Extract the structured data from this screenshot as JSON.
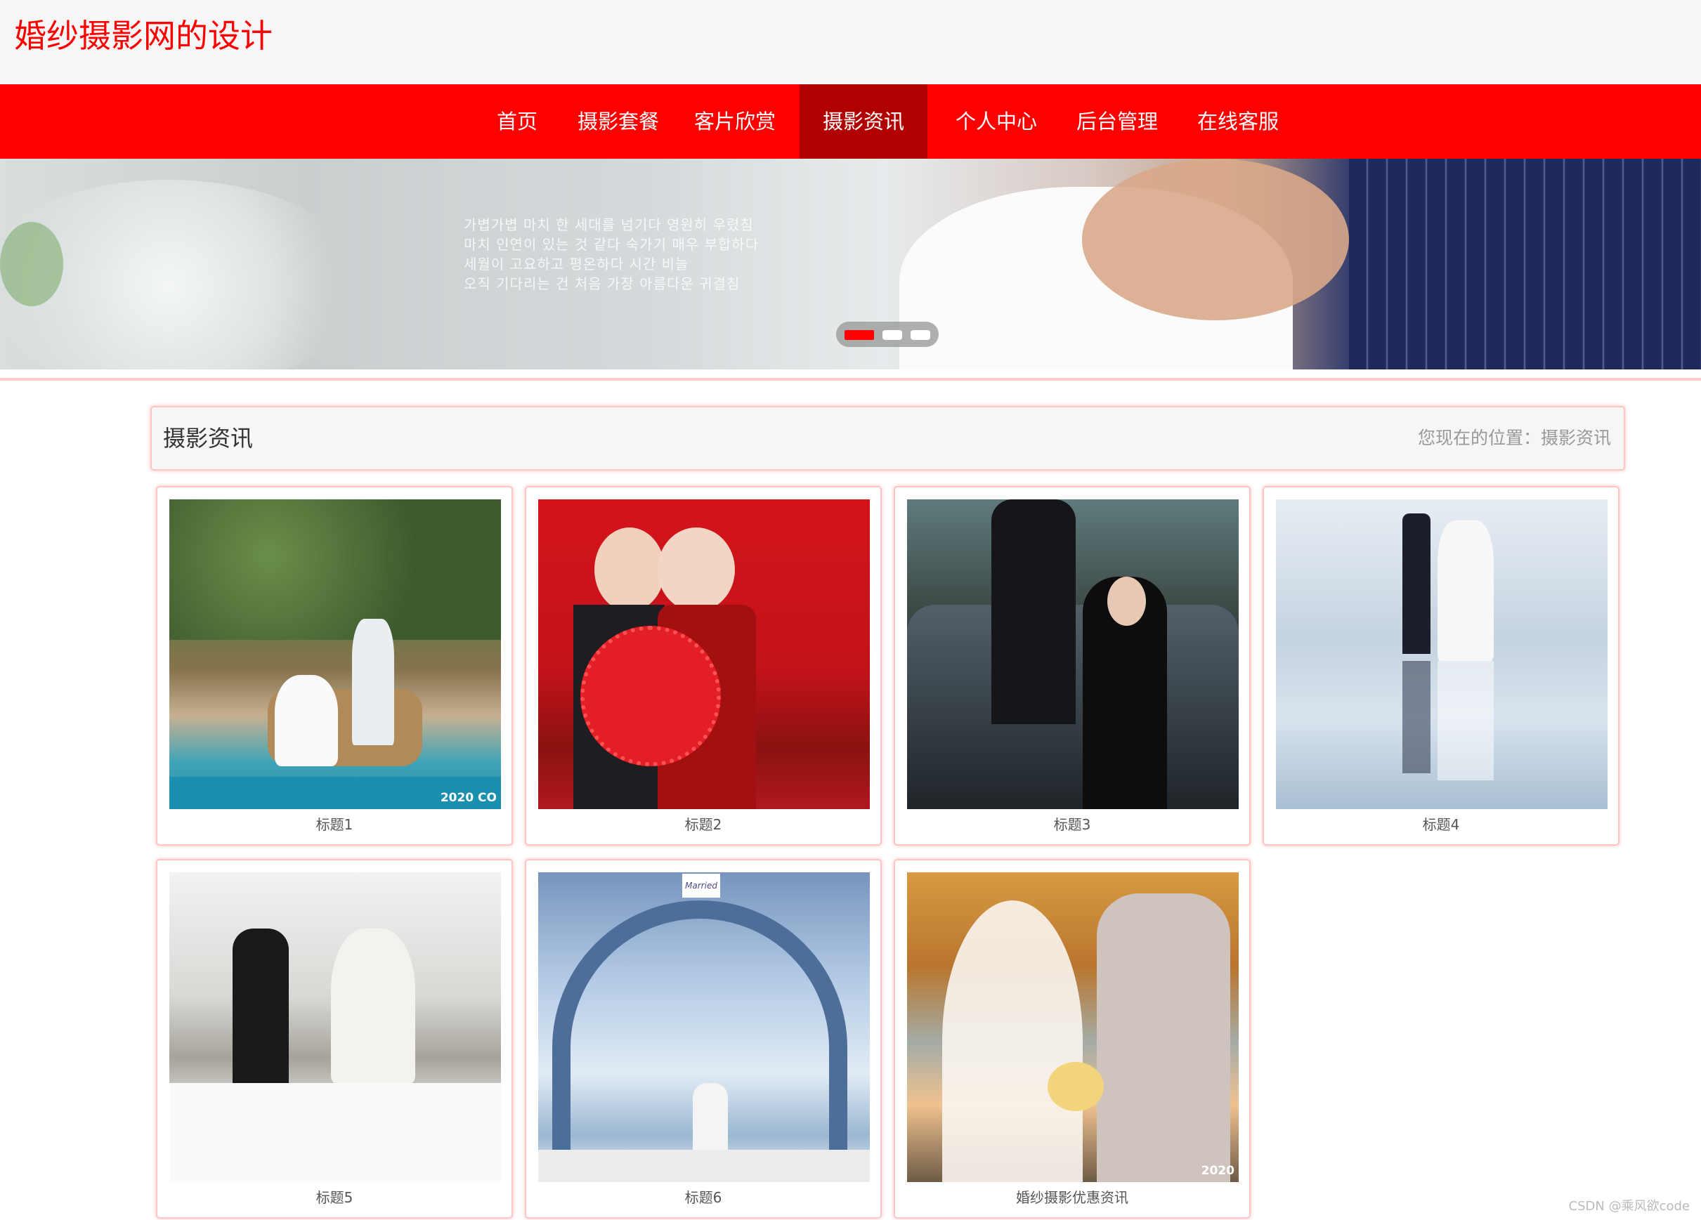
{
  "site": {
    "title": "婚纱摄影网的设计"
  },
  "nav": {
    "items": [
      "首页",
      "摄影套餐",
      "客片欣赏",
      "摄影资讯",
      "个人中心",
      "后台管理",
      "在线客服"
    ],
    "active": "摄影资讯"
  },
  "banner": {
    "text_lines": [
      "가볍가볍 마치 한 세대를 넘기다 영원히 우렸침",
      "마치 인연이 있는 것 같다 숙가기 매우 부합하다",
      "세월이 고요하고 평온하다 시간 비늘",
      "오직 기다리는 건 처음 가장 아름다운 귀결침"
    ],
    "dots": {
      "count": 3,
      "active_index": 0
    }
  },
  "section": {
    "title": "摄影资讯",
    "breadcrumb": "您现在的位置：摄影资讯"
  },
  "cards": [
    {
      "caption": "标题1",
      "photo_text": "2020 CO"
    },
    {
      "caption": "标题2",
      "photo_text": ""
    },
    {
      "caption": "标题3",
      "photo_text": ""
    },
    {
      "caption": "标题4",
      "photo_text": ""
    },
    {
      "caption": "标题5",
      "photo_text": ""
    },
    {
      "caption": "标题6",
      "photo_text": "Married"
    },
    {
      "caption": "婚纱摄影优惠资讯",
      "photo_text": "2020"
    }
  ],
  "watermark": "CSDN @乘风欲code",
  "colors": {
    "brand_red": "#ff0000",
    "nav_active": "#b10000",
    "card_border": "#ffc4c4"
  }
}
